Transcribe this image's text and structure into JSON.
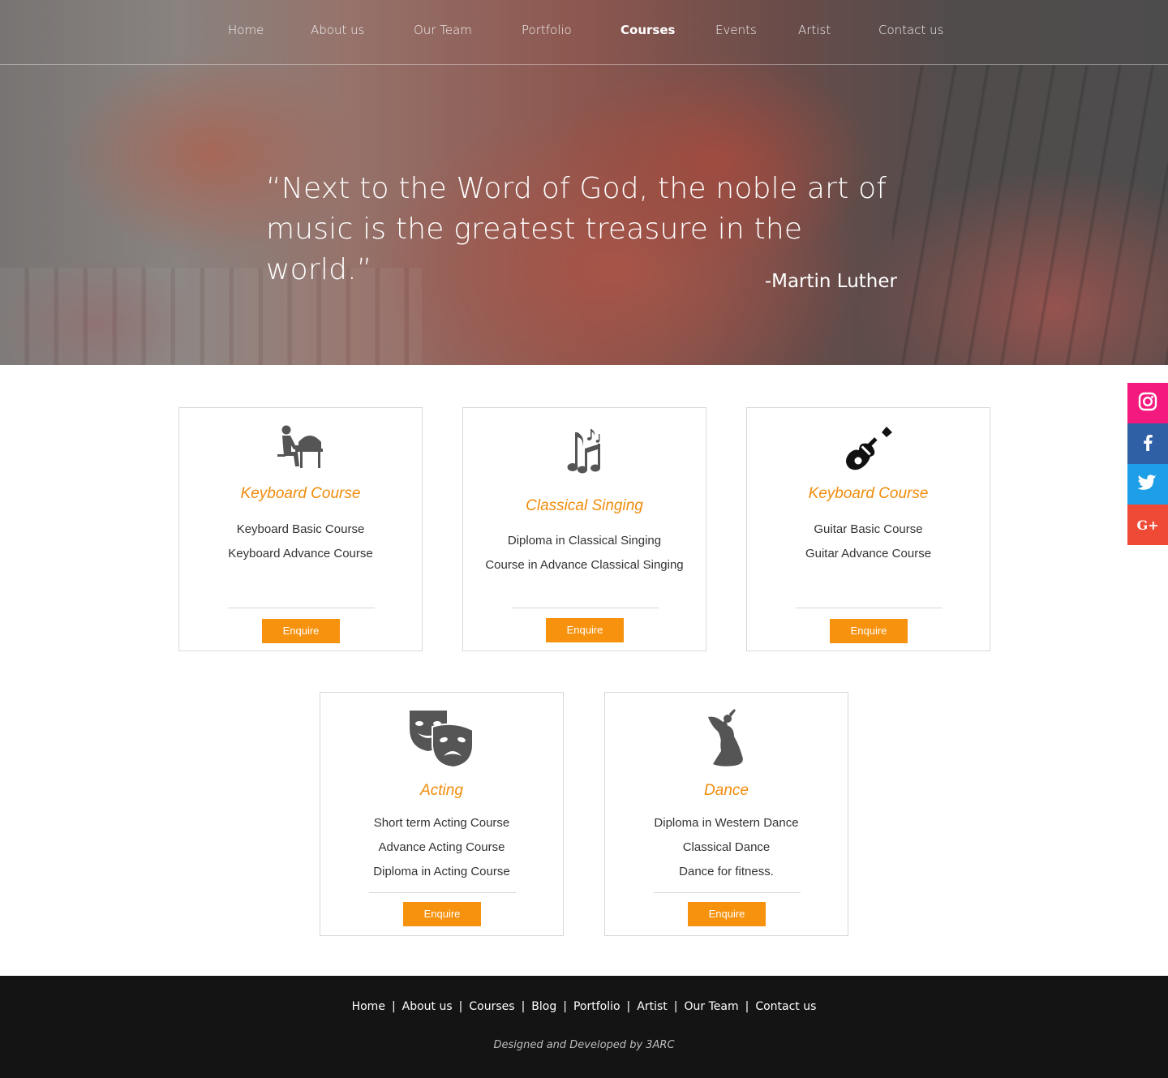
{
  "nav": {
    "items": [
      {
        "label": "Home",
        "active": false
      },
      {
        "label": "About us",
        "active": false
      },
      {
        "label": "Our Team",
        "active": false
      },
      {
        "label": "Portfolio",
        "active": false
      },
      {
        "label": "Courses",
        "active": true
      },
      {
        "label": "Events",
        "active": false
      },
      {
        "label": "Artist",
        "active": false
      },
      {
        "label": "Contact us",
        "active": false
      }
    ]
  },
  "hero": {
    "quote_line1": "“Next to the Word of God, the noble art of",
    "quote_line2": "music is the greatest treasure in the world.”",
    "author": "-Martin Luther"
  },
  "courses": [
    {
      "icon": "pianist-icon",
      "title": "Keyboard Course",
      "items": [
        "Keyboard Basic Course",
        "Keyboard Advance Course"
      ],
      "button": "Enquire"
    },
    {
      "icon": "music-notes-icon",
      "title": "Classical Singing",
      "items": [
        "Diploma in Classical Singing",
        "Course in Advance Classical Singing"
      ],
      "button": "Enquire"
    },
    {
      "icon": "guitar-icon",
      "title": "Keyboard Course",
      "items": [
        "Guitar Basic Course",
        "Guitar Advance Course"
      ],
      "button": "Enquire"
    },
    {
      "icon": "theater-masks-icon",
      "title": "Acting",
      "items": [
        "Short term Acting Course",
        "Advance Acting Course",
        "Diploma in Acting Course"
      ],
      "button": "Enquire"
    },
    {
      "icon": "dancer-icon",
      "title": "Dance",
      "items": [
        "Diploma in Western Dance",
        "Classical Dance",
        "Dance for fitness."
      ],
      "button": "Enquire"
    }
  ],
  "social": [
    {
      "icon": "instagram-icon",
      "color": "#f4197e"
    },
    {
      "icon": "facebook-icon",
      "color": "#2f5fa4"
    },
    {
      "icon": "twitter-icon",
      "color": "#1d9ee6"
    },
    {
      "icon": "google-plus-icon",
      "color": "#ee4a36",
      "label": "G+"
    }
  ],
  "footer": {
    "links": [
      "Home",
      "About us",
      "Courses",
      "Blog",
      "Portfolio",
      "Artist",
      "Our Team",
      "Contact us"
    ],
    "separator": "|",
    "credit": "Designed and Developed by  3ARC"
  },
  "colors": {
    "accent": "#f7920e",
    "title": "#f08c0c",
    "footer_bg": "#141414"
  }
}
